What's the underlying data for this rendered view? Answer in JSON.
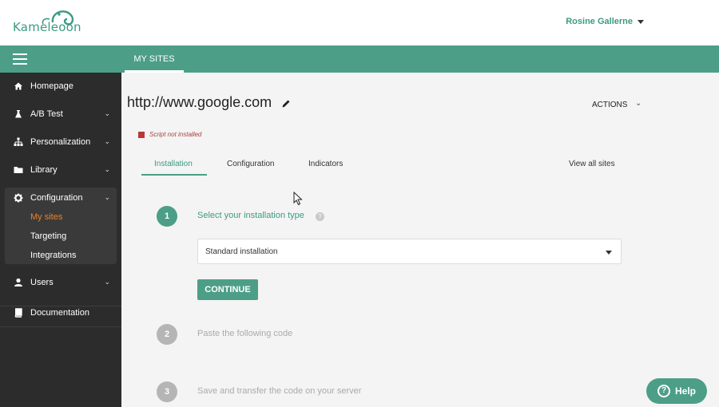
{
  "header": {
    "brand": "Kameleoon",
    "user_name": "Rosine Gallerne"
  },
  "navbar": {
    "tab_my_sites": "MY SITES"
  },
  "sidebar": {
    "items": [
      {
        "label": "Homepage",
        "icon": "home-icon"
      },
      {
        "label": "A/B Test",
        "icon": "flask-icon"
      },
      {
        "label": "Personalization",
        "icon": "sitemap-icon"
      },
      {
        "label": "Library",
        "icon": "folder-icon"
      },
      {
        "label": "Configuration",
        "icon": "gear-icon"
      },
      {
        "label": "Users",
        "icon": "user-icon"
      },
      {
        "label": "Documentation",
        "icon": "book-icon"
      }
    ],
    "config_sub": [
      "My sites",
      "Targeting",
      "Integrations"
    ]
  },
  "site": {
    "url": "http://www.google.com",
    "actions_label": "ACTIONS",
    "status": "Script not installed"
  },
  "tabs": {
    "installation": "Installation",
    "configuration": "Configuration",
    "indicators": "Indicators",
    "view_all": "View all sites"
  },
  "steps": [
    {
      "number": "1",
      "label": "Select your installation type"
    },
    {
      "number": "2",
      "label": "Paste the following code"
    },
    {
      "number": "3",
      "label": "Save and transfer the code on your server"
    }
  ],
  "install_select": {
    "value": "Standard installation"
  },
  "continue_label": "CONTINUE",
  "help_label": "Help",
  "colors": {
    "brand_green": "#4c9e87",
    "sidebar_bg": "#2c2c2c",
    "active_orange": "#e8832a",
    "status_red": "#b73a3a"
  }
}
